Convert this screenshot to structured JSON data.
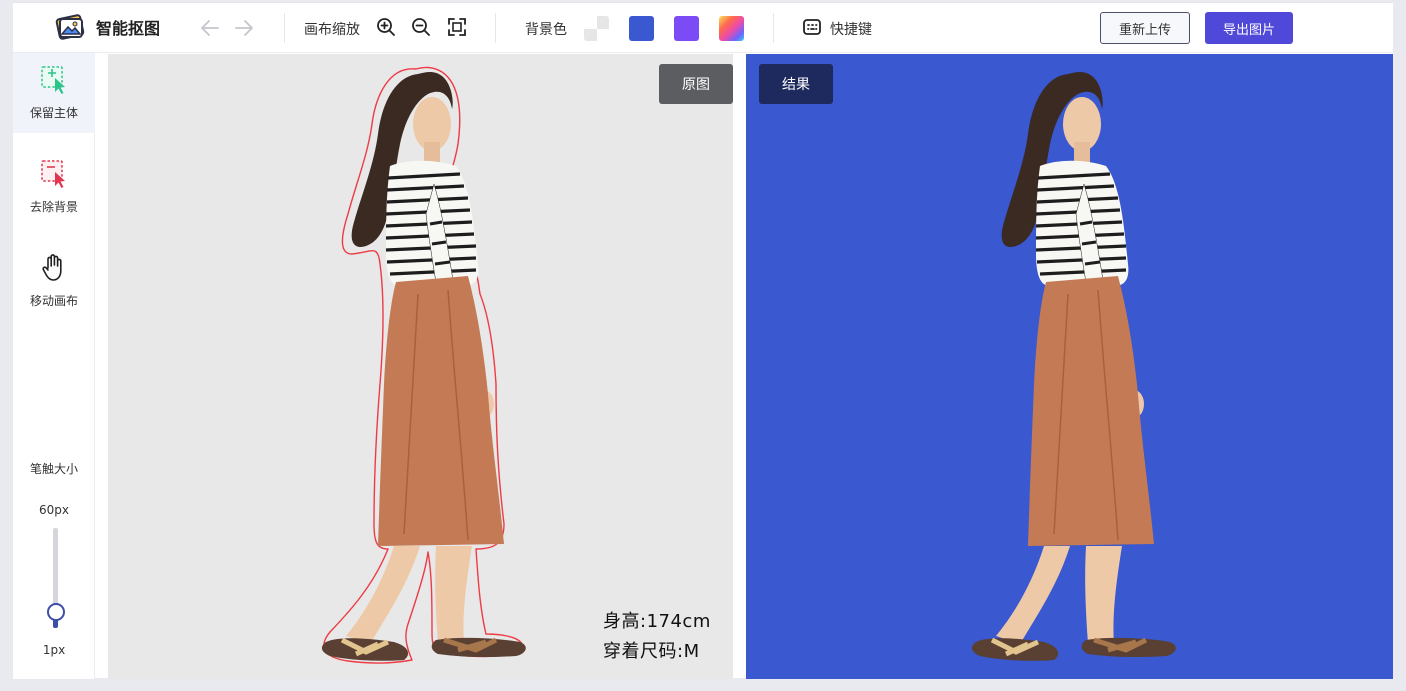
{
  "app": {
    "title": "智能抠图"
  },
  "toolbar": {
    "zoom_label": "画布缩放",
    "bg_label": "背景色",
    "shortcut_label": "快捷键",
    "reupload_label": "重新上传",
    "export_label": "导出图片",
    "bg_colors": [
      "transparent",
      "#3a58cf",
      "#7b4cf5",
      "gradient"
    ],
    "accent": "#5048d8"
  },
  "sidebar": {
    "tools": [
      {
        "label": "保留主体",
        "icon": "keep-subject-icon",
        "active": true
      },
      {
        "label": "去除背景",
        "icon": "remove-background-icon",
        "active": false
      },
      {
        "label": "移动画布",
        "icon": "hand-icon",
        "active": false
      }
    ],
    "brush_label": "笔触大小",
    "brush_max": "60px",
    "brush_min": "1px",
    "brush_level": 0.16
  },
  "canvas": {
    "original_tag": "原图",
    "result_tag": "结果",
    "caption_height": "身高:174cm",
    "caption_size": "穿着尺码:M",
    "result_bg": "#3a58cf"
  }
}
